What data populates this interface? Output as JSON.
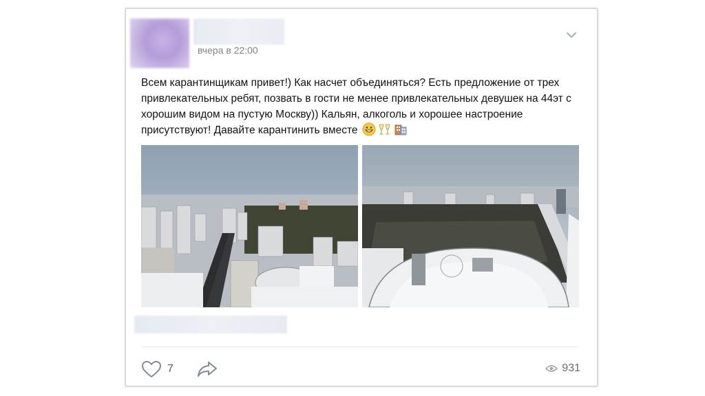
{
  "post": {
    "date": "вчера в 22:00",
    "text_main": "Всем карантинщикам привет!) Как насчет объединяться? Есть предложение от трех привлекательных ребят, позвать в гости не менее привлекательных девушек на 44эт с хорошим видом на пустую Москву)) Кальян, алкоголь и хорошее настроение присутствуют! Давайте карантинить вместе",
    "emojis": [
      "grinning-face-emoji",
      "champagne-glasses-emoji",
      "hotel-building-emoji"
    ],
    "photos": [
      "city-view-photo-left",
      "city-view-photo-right"
    ]
  },
  "footer": {
    "like_count": "7",
    "views_count": "931"
  },
  "icons": {
    "menu": "chevron-down-icon",
    "like": "heart-icon",
    "share": "share-arrow-icon",
    "views": "eye-icon"
  },
  "colors": {
    "icon_gray": "#828a99",
    "text": "#111111",
    "muted_text": "#828282",
    "card_border": "#cfcfcf"
  }
}
